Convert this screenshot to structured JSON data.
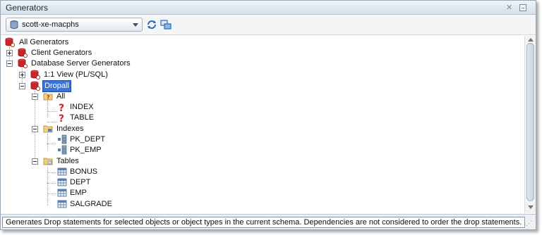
{
  "window": {
    "title": "Generators"
  },
  "toolbar": {
    "connection": "scott-xe-macphs",
    "refresh_icon": "refresh-icon",
    "layout_icon": "layout-icon"
  },
  "tree": {
    "root": "All Generators",
    "client_generators": "Client Generators",
    "db_server_generators": "Database Server Generators",
    "view_plsql": "1:1 View (PL/SQL)",
    "dropall": "Dropall",
    "all": "All",
    "all_items": [
      "INDEX",
      "TABLE"
    ],
    "indexes": "Indexes",
    "index_items": [
      "PK_DEPT",
      "PK_EMP"
    ],
    "tables": "Tables",
    "table_items": [
      "BONUS",
      "DEPT",
      "EMP",
      "SALGRADE"
    ]
  },
  "status": {
    "text": "Generates Drop statements for selected objects or object types in the current schema. Dependencies are not considered to order the drop statements."
  },
  "colors": {
    "selection": "#3875d7",
    "generator_red": "#c8262b",
    "folder": "#e2c25a",
    "table_blue": "#5a7fb5"
  }
}
